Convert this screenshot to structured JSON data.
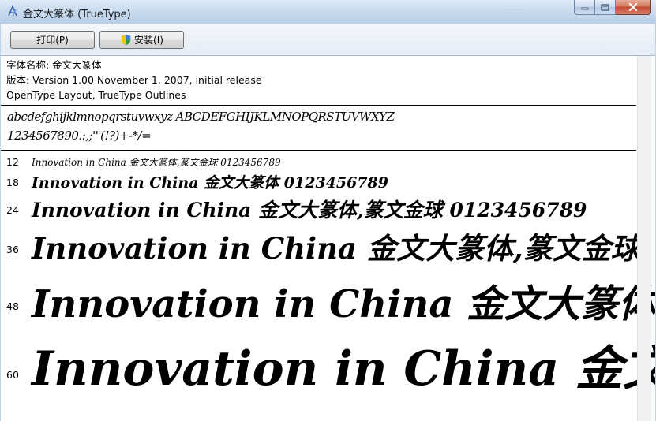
{
  "window": {
    "title": "金文大篆体 (TrueType)",
    "ghost_title": "……"
  },
  "toolbar": {
    "print_label": "打印(P)",
    "install_label": "安装(I)"
  },
  "font_info": {
    "name_line": "字体名称: 金文大篆体",
    "version_line": "版本: Version 1.00 November 1, 2007, initial release",
    "type_line": "OpenType Layout, TrueType Outlines"
  },
  "charset": {
    "line1": "abcdefghijklmnopqrstuvwxyz ABCDEFGHIJKLMNOPQRSTUVWXYZ",
    "line2": "1234567890.:,;'\"(!?)+-*/="
  },
  "samples": [
    {
      "size": "12",
      "text": "Innovation in China 金文大篆体,篆文金球 0123456789"
    },
    {
      "size": "18",
      "text": "Innovation in China 金文大篆体 0123456789"
    },
    {
      "size": "24",
      "text": "Innovation in China 金文大篆体,篆文金球 0123456789"
    },
    {
      "size": "36",
      "text": "Innovation in China 金文大篆体,篆文金球"
    },
    {
      "size": "48",
      "text": "Innovation in China 金文大篆体,"
    },
    {
      "size": "60",
      "text": "Innovation in China 金文大"
    }
  ]
}
